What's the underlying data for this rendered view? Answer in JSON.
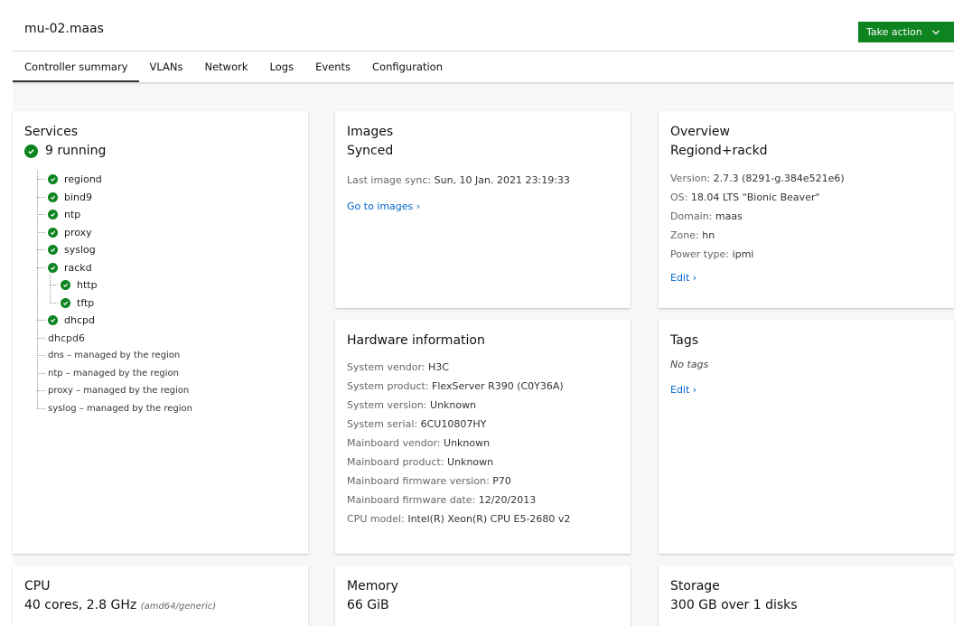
{
  "header": {
    "hostname": "mu-02.maas",
    "take_action_label": "Take action"
  },
  "tabs": [
    "Controller summary",
    "VLANs",
    "Network",
    "Logs",
    "Events",
    "Configuration"
  ],
  "services": {
    "title": "Services",
    "running": "9 running",
    "items": [
      {
        "name": "regiond",
        "status": "running"
      },
      {
        "name": "bind9",
        "status": "running"
      },
      {
        "name": "ntp",
        "status": "running"
      },
      {
        "name": "proxy",
        "status": "running"
      },
      {
        "name": "syslog",
        "status": "running"
      },
      {
        "name": "rackd",
        "status": "running",
        "children": [
          {
            "name": "http",
            "status": "running"
          },
          {
            "name": "tftp",
            "status": "running"
          }
        ]
      },
      {
        "name": "dhcpd",
        "status": "running"
      },
      {
        "name": "dhcpd6",
        "status": "off"
      },
      {
        "name": "dns – managed by the region",
        "status": "off"
      },
      {
        "name": "ntp – managed by the region",
        "status": "off"
      },
      {
        "name": "proxy – managed by the region",
        "status": "off"
      },
      {
        "name": "syslog – managed by the region",
        "status": "off"
      }
    ]
  },
  "images": {
    "title": "Images",
    "status": "Synced",
    "last_sync_label": "Last image sync:",
    "last_sync_value": "Sun, 10 Jan. 2021 23:19:33",
    "link": "Go to images ›"
  },
  "overview": {
    "title": "Overview",
    "subtitle": "Regiond+rackd",
    "rows": [
      {
        "label": "Version:",
        "value": "2.7.3 (8291-g.384e521e6)"
      },
      {
        "label": "OS:",
        "value": "18.04 LTS \"Bionic Beaver\""
      },
      {
        "label": "Domain:",
        "value": "maas"
      },
      {
        "label": "Zone:",
        "value": "hn"
      },
      {
        "label": "Power type:",
        "value": "ipmi"
      }
    ],
    "edit": "Edit ›"
  },
  "hardware": {
    "title": "Hardware information",
    "rows": [
      {
        "label": "System vendor:",
        "value": "H3C"
      },
      {
        "label": "System product:",
        "value": "FlexServer R390 (C0Y36A)"
      },
      {
        "label": "System version:",
        "value": "Unknown"
      },
      {
        "label": "System serial:",
        "value": "6CU10807HY"
      },
      {
        "label": "Mainboard vendor:",
        "value": "Unknown"
      },
      {
        "label": "Mainboard product:",
        "value": "Unknown"
      },
      {
        "label": "Mainboard firmware version:",
        "value": "P70"
      },
      {
        "label": "Mainboard firmware date:",
        "value": "12/20/2013"
      },
      {
        "label": "CPU model:",
        "value": "Intel(R) Xeon(R) CPU E5-2680 v2"
      }
    ]
  },
  "tags": {
    "title": "Tags",
    "empty": "No tags",
    "edit": "Edit ›"
  },
  "cpu": {
    "title": "CPU",
    "value": "40 cores, 2.8 GHz",
    "arch": "(amd64/generic)"
  },
  "memory": {
    "title": "Memory",
    "value": "66 GiB"
  },
  "storage": {
    "title": "Storage",
    "value": "300 GB over 1 disks"
  },
  "colors": {
    "accent_green": "#0e8420",
    "link_blue": "#0066cc"
  }
}
